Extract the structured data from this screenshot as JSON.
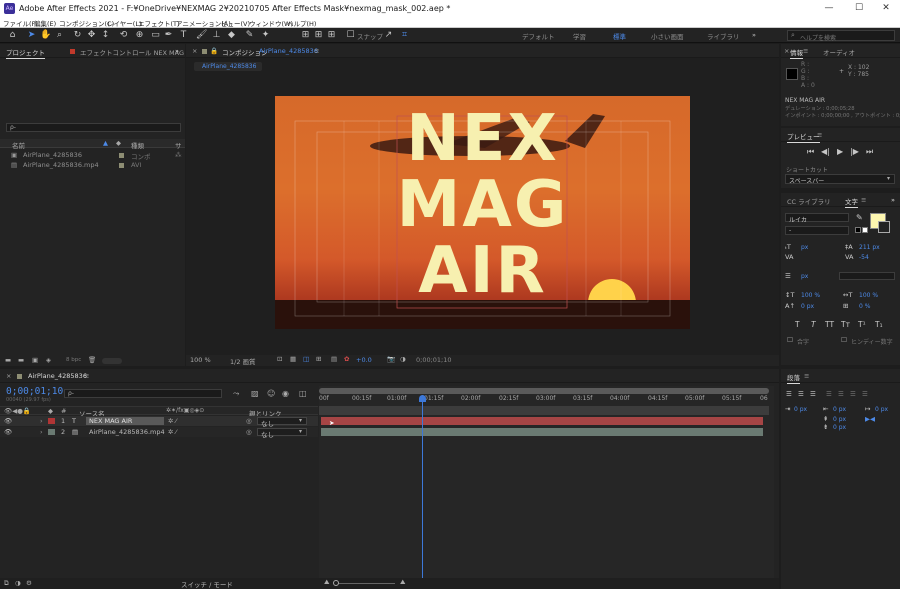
{
  "app": {
    "title": "Adobe After Effects 2021 - F:¥OneDrive¥NEXMAG 2¥20210705 After Effects Mask¥nexmag_mask_002.aep *",
    "icon_text": "Ae",
    "min": "—",
    "max": "☐",
    "close": "✕"
  },
  "menu": [
    "ファイル(F)",
    "編集(E)",
    "コンポジション(C)",
    "レイヤー(L)",
    "エフェクト(T)",
    "アニメーション(A)",
    "ビュー(V)",
    "ウィンドウ(W)",
    "ヘルプ(H)"
  ],
  "toolbar": {
    "snap_label": "スナップ",
    "workspaces": [
      "デフォルト",
      "学習",
      "標準",
      "小さい画面",
      "ライブラリ"
    ],
    "active_workspace": "標準",
    "help_search_placeholder": "ヘルプを検索"
  },
  "project": {
    "tab_project": "プロジェクト",
    "tab_effects": "エフェクトコントロール NEX MAG",
    "columns": {
      "name": "名前",
      "type": "種類",
      "size": "サ"
    },
    "items": [
      {
        "name": "AirPlane_4285836",
        "type": "コンポ"
      },
      {
        "name": "AirPlane_4285836.mp4",
        "type": "AVI"
      }
    ],
    "bpc": "8 bpc"
  },
  "composition": {
    "tab_label": "コンポジション",
    "comp_name": "AirPlane_4285836",
    "sub_tab": "AirPlane_4285836",
    "title_lines": [
      "NEX",
      "MAG",
      "AIR"
    ],
    "text_color": "#f7f0b0",
    "zoom": "100 %",
    "resolution": "1/2 画質",
    "exposure": "+0.0",
    "timecode": "0;00;01;10"
  },
  "info": {
    "tab_info": "情報",
    "tab_audio": "オーディオ",
    "r": "R :",
    "g": "G :",
    "b": "B :",
    "a": "A : 0",
    "x": "X : 102",
    "y": "Y : 785",
    "layer_name": "NEX MAG AIR",
    "duration": "デュレーション : 0;00;05;28",
    "in_out": "インポイント : 0;00;00;00 , アウトポイント : 0;00;05;27"
  },
  "preview": {
    "tab": "プレビュー",
    "shortcut_label": "ショートカット",
    "shortcut_value": "スペースバー"
  },
  "character": {
    "tab_libraries": "CC ライブラリ",
    "tab_character": "文字",
    "font": "ルイカ",
    "style": "-",
    "size_unit": "px",
    "leading": "211 px",
    "tracking": "-54",
    "line_unit": "px",
    "v_scale": "100 %",
    "h_scale": "100 %",
    "baseline": "0 px",
    "tsume": "0 %",
    "ligature": "合字",
    "hindi": "ヒンディー数字",
    "fill_color": "#fdf6b0",
    "style_buttons": [
      "T",
      "T",
      "TT",
      "Tт",
      "T¹",
      "T₁"
    ]
  },
  "paragraph": {
    "tab": "段落",
    "values": [
      "0 px",
      "0 px",
      "0 px",
      "0 px",
      "0 px"
    ]
  },
  "timeline": {
    "tab": "AirPlane_4285836",
    "timecode": "0;00;01;10",
    "fps_info": "00040 (29.97 fps)",
    "search_placeholder": "ρ-",
    "col_source": "ソース名",
    "col_parent": "親とリンク",
    "ruler": [
      "00f",
      "00:15f",
      "01:00f",
      "01:15f",
      "02:00f",
      "02:15f",
      "03:00f",
      "03:15f",
      "04:00f",
      "04:15f",
      "05:00f",
      "05:15f",
      "06"
    ],
    "layers": [
      {
        "num": "1",
        "name": "NEX MAG AIR",
        "parent": "なし",
        "color": "#b03535"
      },
      {
        "num": "2",
        "name": "AirPlane_4285836.mp4",
        "parent": "なし",
        "color": "#6a7a72"
      }
    ],
    "footer": "スイッチ / モード"
  }
}
